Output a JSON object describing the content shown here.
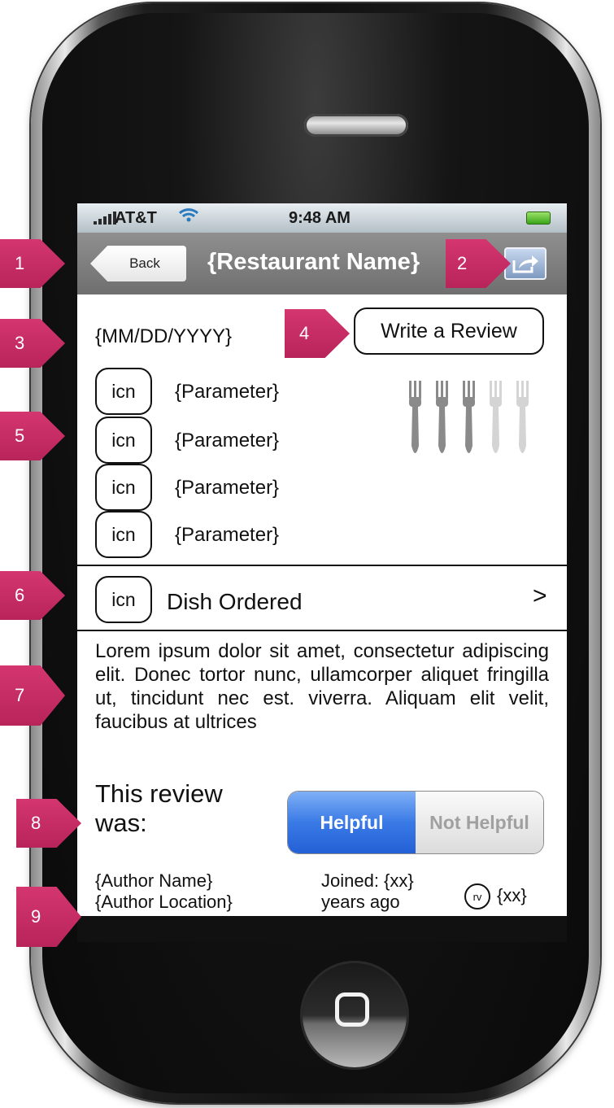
{
  "status_bar": {
    "carrier": "AT&T",
    "time": "9:48 AM"
  },
  "nav": {
    "back_label": "Back",
    "title": "{Restaurant Name}"
  },
  "review": {
    "date": "{MM/DD/YYYY}",
    "write_review_label": "Write a Review",
    "parameters": [
      {
        "icon": "icn",
        "label": "{Parameter}"
      },
      {
        "icon": "icn",
        "label": "{Parameter}"
      },
      {
        "icon": "icn",
        "label": "{Parameter}"
      },
      {
        "icon": "icn",
        "label": "{Parameter}"
      }
    ],
    "fork_rating": {
      "filled": 3,
      "total": 5
    },
    "dish": {
      "icon": "icn",
      "label": "Dish Ordered",
      "chevron": ">"
    },
    "text": "Lorem ipsum dolor sit amet, consectetur adipiscing elit. Donec tortor nunc, ullamcorper aliquet fringilla ut, tincidunt nec est. viverra. Aliquam elit velit, faucibus at ultrices",
    "helpful_prompt": "This review was:",
    "helpful_label": "Helpful",
    "not_helpful_label": "Not Helpful",
    "author_name": "{Author Name}",
    "author_location": "{Author Location}",
    "joined": "Joined: {xx} years ago",
    "rv_badge": "rv",
    "review_count": "{xx}"
  },
  "markers": [
    "1",
    "2",
    "3",
    "4",
    "5",
    "6",
    "7",
    "8",
    "9"
  ],
  "colors": {
    "marker": "#c42c63",
    "nav_bar": "#7f7f7f",
    "helpful_active": "#3a7ae6",
    "not_helpful": "#dcdcdc"
  }
}
